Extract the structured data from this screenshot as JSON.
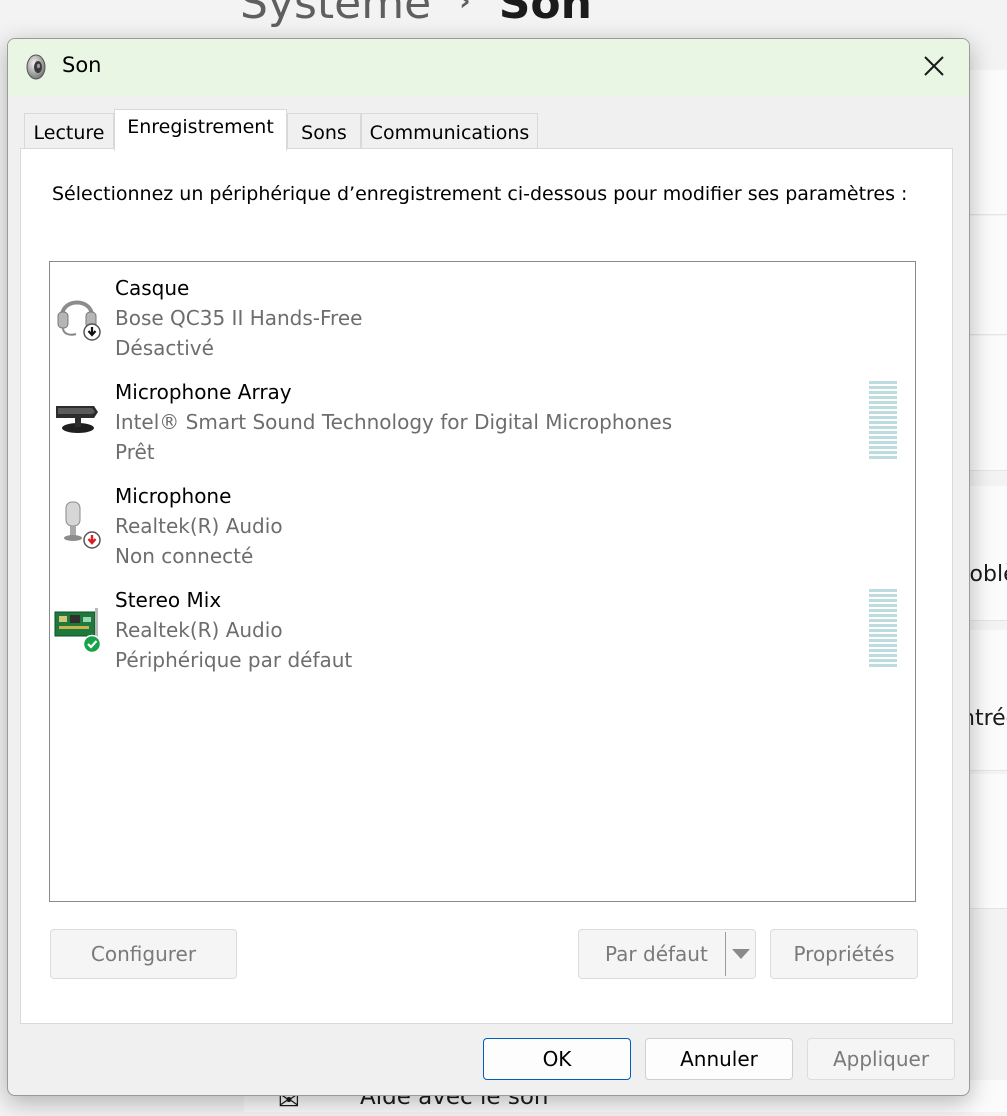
{
  "background": {
    "breadcrumb_parent": "Système",
    "breadcrumb_separator": "›",
    "breadcrumb_current": "Son",
    "partial_text_1": "roblè",
    "partial_text_2": "ntrée",
    "help_icon": "help-chat-icon",
    "help_label": "Aide avec le son"
  },
  "dialog": {
    "title": "Son",
    "title_icon": "speaker-icon",
    "close_icon": "close-icon",
    "tabs": [
      {
        "label": "Lecture",
        "active": false
      },
      {
        "label": "Enregistrement",
        "active": true
      },
      {
        "label": "Sons",
        "active": false
      },
      {
        "label": "Communications",
        "active": false
      }
    ],
    "instruction": "Sélectionnez un périphérique d’enregistrement ci-dessous pour modifier ses paramètres :",
    "devices": [
      {
        "name": "Casque",
        "description": "Bose QC35 II Hands-Free",
        "status": "Désactivé",
        "icon": "headset-disabled-icon",
        "level_meter": false
      },
      {
        "name": "Microphone Array",
        "description": "Intel® Smart Sound Technology for Digital Microphones",
        "status": "Prêt",
        "icon": "microphone-array-icon",
        "level_meter": true
      },
      {
        "name": "Microphone",
        "description": "Realtek(R) Audio",
        "status": "Non connecté",
        "icon": "microphone-unplugged-icon",
        "level_meter": false
      },
      {
        "name": "Stereo Mix",
        "description": "Realtek(R) Audio",
        "status": "Périphérique par défaut",
        "icon": "sound-card-default-icon",
        "level_meter": true
      }
    ],
    "buttons": {
      "configure": "Configurer",
      "set_default": "Par défaut",
      "properties": "Propriétés",
      "ok": "OK",
      "cancel": "Annuler",
      "apply": "Appliquer"
    },
    "colors": {
      "titlebar": "#e9f6e4",
      "ok_border": "#005fb8",
      "meter": "#bcdce0",
      "default_badge": "#16a34a",
      "unplugged_badge": "#d92020"
    }
  }
}
